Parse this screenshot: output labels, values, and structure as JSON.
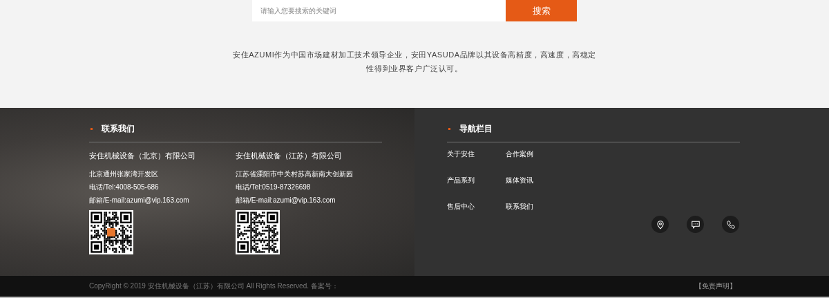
{
  "search": {
    "placeholder": "请输入您要搜索的关键词",
    "button": "搜索"
  },
  "intro": "安住AZUMI作为中国市场建材加工技术领导企业，安田YASUDA品牌以其设备高精度，高速度，高稳定性得到业界客户广泛认可。",
  "contact": {
    "title": "联系我们",
    "companies": [
      {
        "name": "安住机械设备（北京）有限公司",
        "address": "北京通州张家湾开发区",
        "tel": "电话/Tel:4008-505-686",
        "email": "邮箱/E-mail:azumi@vip.163.com",
        "qr_logo": true
      },
      {
        "name": "安住机械设备（江苏）有限公司",
        "address": "江苏省溧阳市中关村苏高新南大创新园",
        "tel": "电话/Tel:0519-87326698",
        "email": "邮箱/E-mail:azumi@vip.163.com",
        "qr_logo": false
      }
    ]
  },
  "nav": {
    "title": "导航栏目",
    "links": [
      "关于安住",
      "合作案例",
      "产品系列",
      "媒体资讯",
      "售后中心",
      "联系我们"
    ]
  },
  "footer": {
    "copyright": "CopyRight © 2019 安住机械设备（江苏）有限公司 All Rights Reserved. 备案号：",
    "disclaimer": "【免责声明】"
  }
}
